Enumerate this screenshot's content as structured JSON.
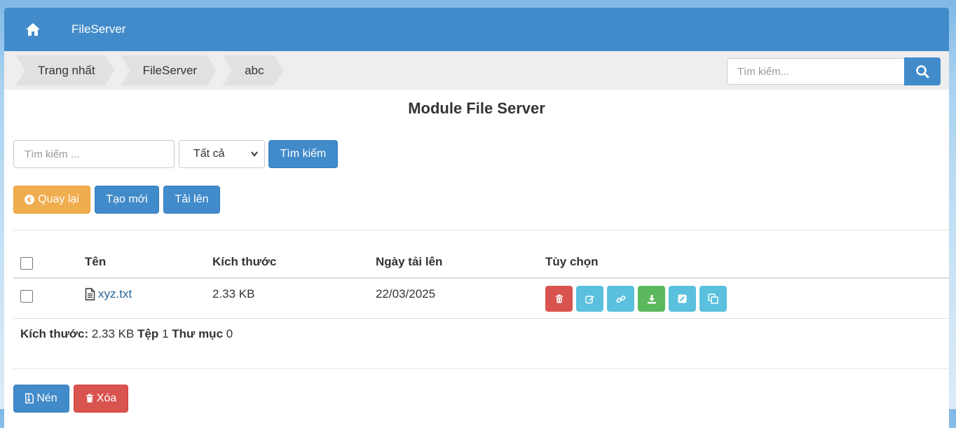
{
  "navbar": {
    "brand": "FileServer",
    "home_icon": "home-icon"
  },
  "breadcrumb": [
    "Trang nhất",
    "FileServer",
    "abc"
  ],
  "top_search": {
    "placeholder": "Tìm kiếm...",
    "icon": "search-icon"
  },
  "page_title": "Module File Server",
  "filter": {
    "search_placeholder": "Tìm kiếm ...",
    "select_value": "Tất cả",
    "search_button": "Tìm kiếm"
  },
  "actions": {
    "back": "Quay lại",
    "create": "Tạo mới",
    "upload": "Tải lên"
  },
  "table": {
    "headers": {
      "name": "Tên",
      "size": "Kích thước",
      "date": "Ngày tải lên",
      "options": "Tùy chọn"
    },
    "rows": [
      {
        "name": "xyz.txt",
        "size": "2.33 KB",
        "date": "22/03/2025"
      }
    ],
    "row_options": [
      "delete-icon",
      "edit-icon",
      "link-icon",
      "download-icon",
      "rename-icon",
      "copy-icon"
    ]
  },
  "summary": {
    "size_label": "Kích thước:",
    "size_value": "2.33 KB",
    "files_label": "Tệp",
    "files_value": "1",
    "folders_label": "Thư mục",
    "folders_value": "0"
  },
  "bottom": {
    "compress": "Nén",
    "delete": "Xóa"
  },
  "colors": {
    "primary": "#428bca",
    "warning": "#f0ad4e",
    "danger": "#d9534f",
    "info": "#5bc0de",
    "success": "#5cb85c"
  }
}
